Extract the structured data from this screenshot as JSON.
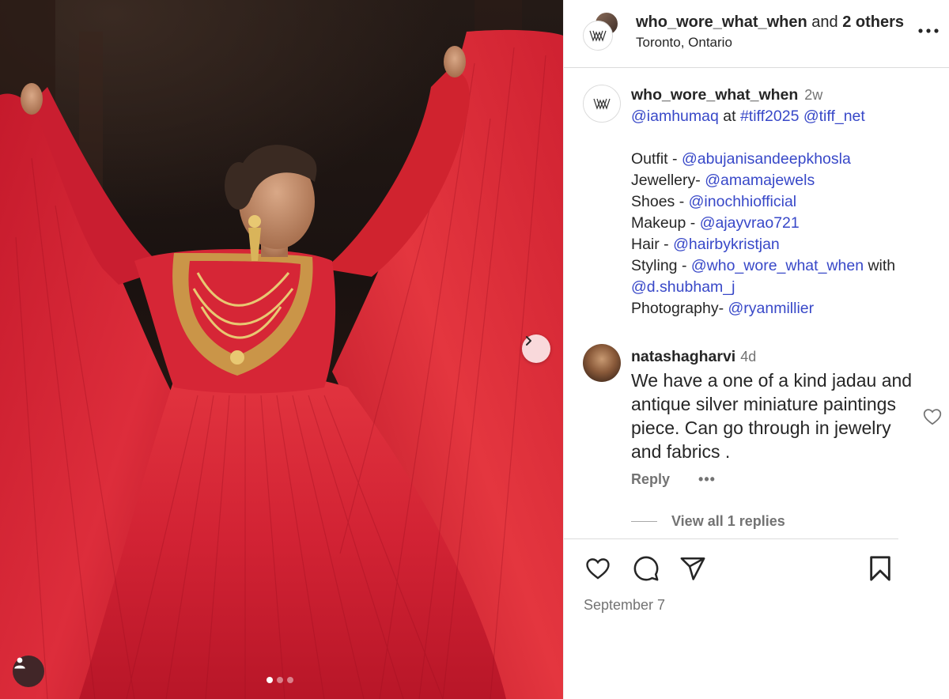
{
  "post": {
    "author_line_user": "who_wore_what_when",
    "author_line_mid": " and ",
    "author_line_others": "2 others",
    "location": "Toronto, Ontario",
    "carousel_dots": 3,
    "carousel_active_index": 0
  },
  "caption": {
    "username": "who_wore_what_when",
    "time": "2w",
    "line1_mention1": "@iamhumaq",
    "line1_at": " at ",
    "line1_tag": "#tiff2025",
    "line1_mention2": "@tiff_net",
    "credits": [
      {
        "label": "Outfit - ",
        "handle": "@abujanisandeepkhosla"
      },
      {
        "label": "Jewellery- ",
        "handle": "@amamajewels"
      },
      {
        "label": "Shoes - ",
        "handle": "@inochhiofficial"
      },
      {
        "label": "Makeup - ",
        "handle": "@ajayvrao721"
      },
      {
        "label": "Hair - ",
        "handle": "@hairbykristjan"
      },
      {
        "label": "Styling - ",
        "handle": "@who_wore_what_when",
        "suffix": " with"
      },
      {
        "label": "",
        "handle": "@d.shubham_j"
      },
      {
        "label": "Photography- ",
        "handle": "@ryanmillier"
      }
    ]
  },
  "comment": {
    "username": "natashagharvi",
    "time": "4d",
    "text": "We have a one of a kind jadau and antique silver miniature paintings piece. Can go through in jewelry and fabrics .",
    "reply_label": "Reply",
    "more_label": "•••",
    "view_replies_label": "View all 1 replies"
  },
  "footer": {
    "date": "September 7"
  },
  "icons": {
    "header_more": "more-horizontal-icon",
    "next": "chevron-right-icon",
    "tag": "user-icon",
    "like": "heart-icon",
    "comment": "comment-icon",
    "share": "send-icon",
    "save": "bookmark-icon"
  },
  "colors": {
    "link": "#3848c8",
    "dress": "#d8293a",
    "muted": "#737373"
  }
}
